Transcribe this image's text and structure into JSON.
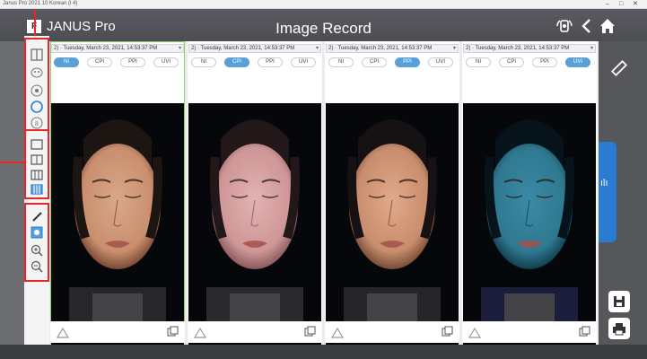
{
  "os": {
    "title": "Janus Pro 2021 10 Korean (l 4)",
    "controls": [
      "–",
      "□",
      "✕"
    ]
  },
  "header": {
    "logo": "F",
    "app_name": "JANUS Pro",
    "title": "Image Record",
    "icons": [
      "camera-icon",
      "back-icon",
      "home-icon"
    ]
  },
  "left_toolbar": {
    "group1": [
      "split-view-icon",
      "face-scan-icon",
      "spot-icon",
      "circle-icon",
      "eye-icon"
    ],
    "group2": [
      "single-layout-icon",
      "dual-layout-icon",
      "triple-layout-icon",
      "quad-layout-icon"
    ],
    "group3": [
      "pen-icon",
      "eraser-icon",
      "zoom-in-icon",
      "zoom-out-icon"
    ]
  },
  "panels": [
    {
      "date": "2) · Tuesday, March 23, 2021, 14:53:37 PM",
      "modes": [
        "NI",
        "CPI",
        "PPI",
        "UVI"
      ],
      "active_mode": "NI",
      "selected": true,
      "tone": "normal"
    },
    {
      "date": "2) · Tuesday, March 23, 2021, 14:53:37 PM",
      "modes": [
        "NI",
        "CPI",
        "PPI",
        "UVI"
      ],
      "active_mode": "CPI",
      "selected": false,
      "tone": "polarized"
    },
    {
      "date": "2) · Tuesday, March 23, 2021, 14:53:37 PM",
      "modes": [
        "NI",
        "CPI",
        "PPI",
        "UVI"
      ],
      "active_mode": "PPI",
      "selected": false,
      "tone": "parallel"
    },
    {
      "date": "2) · Tuesday, March 23, 2021, 14:53:37 PM",
      "modes": [
        "NI",
        "CPI",
        "PPI",
        "UVI"
      ],
      "active_mode": "UVI",
      "selected": false,
      "tone": "uv"
    }
  ],
  "right_toolbar": {
    "icons": [
      "ruler-icon",
      "chart-icon",
      "save-icon",
      "print-icon"
    ],
    "chart_glyph": "ılı"
  },
  "colors": {
    "accent": "#5aa0d8",
    "highlight": "#e8262a",
    "selection": "#8ad06a",
    "chart_tab": "#2a7bd1"
  }
}
